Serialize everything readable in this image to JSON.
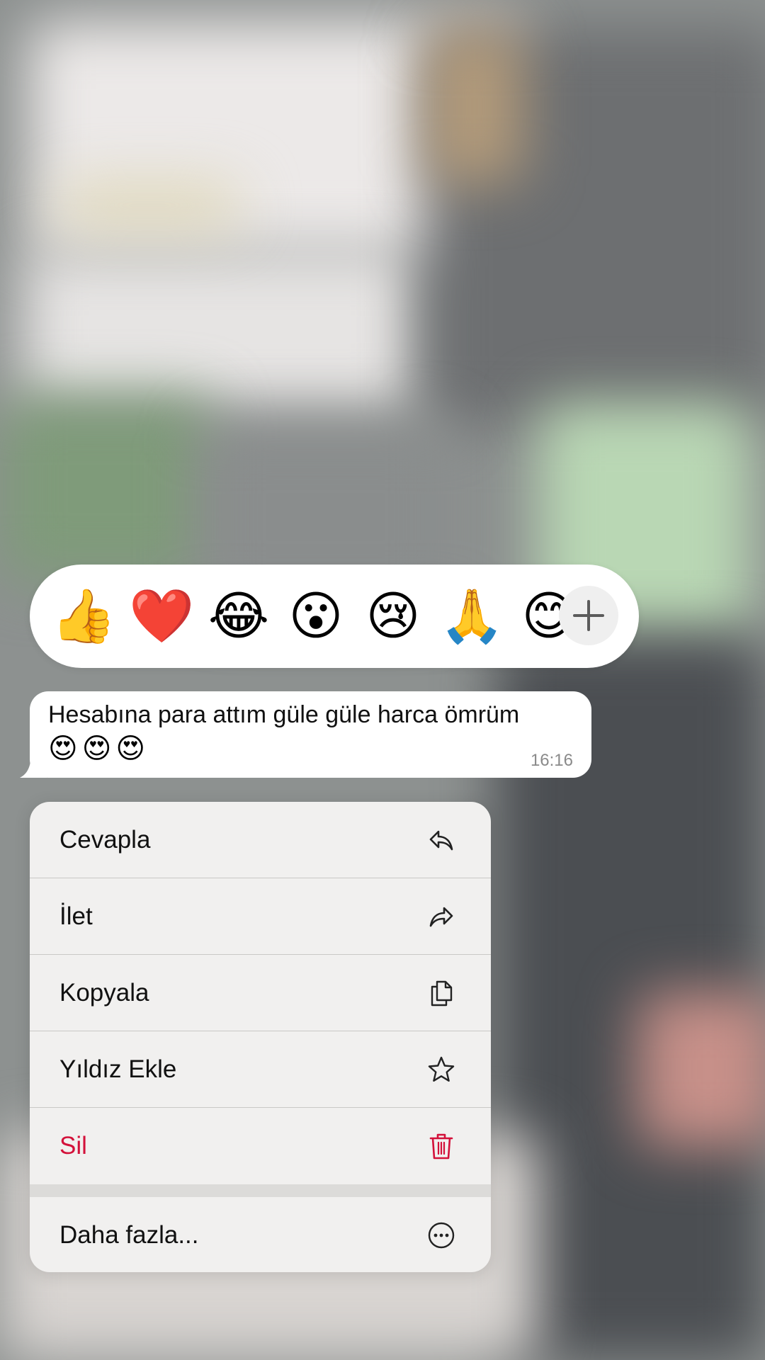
{
  "reactions": {
    "emojis": [
      "👍",
      "❤️",
      "😂",
      "😮",
      "😢",
      "🙏",
      "😊"
    ],
    "more_icon": "plus-icon"
  },
  "message": {
    "text": "Hesabına para attım güle güle harca ömrüm",
    "emojis": "😍😍😍",
    "time": "16:16"
  },
  "menu": {
    "items": [
      {
        "label": "Cevapla",
        "icon": "reply-icon"
      },
      {
        "label": "İlet",
        "icon": "forward-icon"
      },
      {
        "label": "Kopyala",
        "icon": "copy-icon"
      },
      {
        "label": "Yıldız Ekle",
        "icon": "star-icon"
      },
      {
        "label": "Sil",
        "icon": "trash-icon",
        "color": "#d3113a"
      },
      {
        "label": "Daha fazla...",
        "icon": "more-icon"
      }
    ]
  }
}
